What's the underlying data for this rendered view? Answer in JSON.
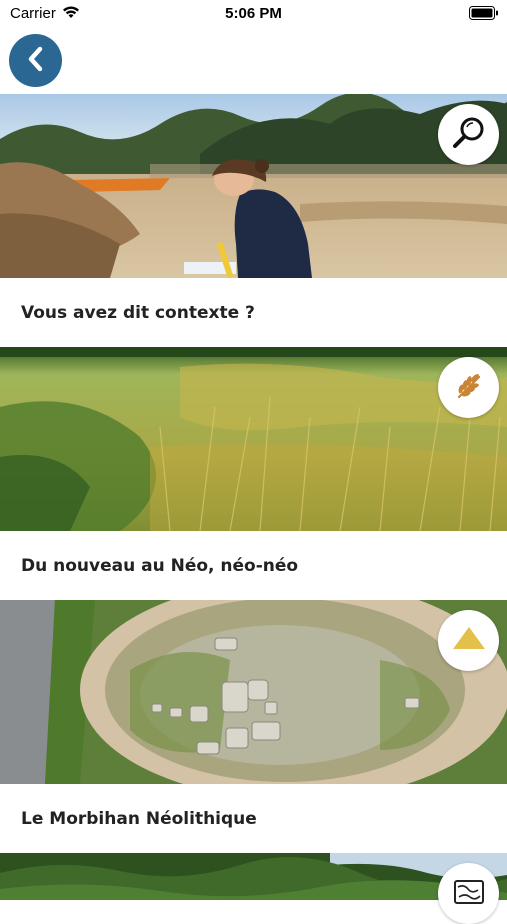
{
  "status_bar": {
    "carrier": "Carrier",
    "time": "5:06 PM"
  },
  "nav": {
    "back_icon": "chevron-left-icon"
  },
  "colors": {
    "back_button": "#2b6793",
    "accent_icon": "#c98436",
    "triangle_icon": "#e2c04a"
  },
  "cards": [
    {
      "title": "Vous avez dit contexte ?",
      "icon": "magnifier-icon"
    },
    {
      "title": "Du nouveau au Néo, néo-néo",
      "icon": "wheat-icon"
    },
    {
      "title": "Le Morbihan Néolithique",
      "icon": "triangle-icon"
    },
    {
      "title": "",
      "icon": "map-icon"
    }
  ]
}
